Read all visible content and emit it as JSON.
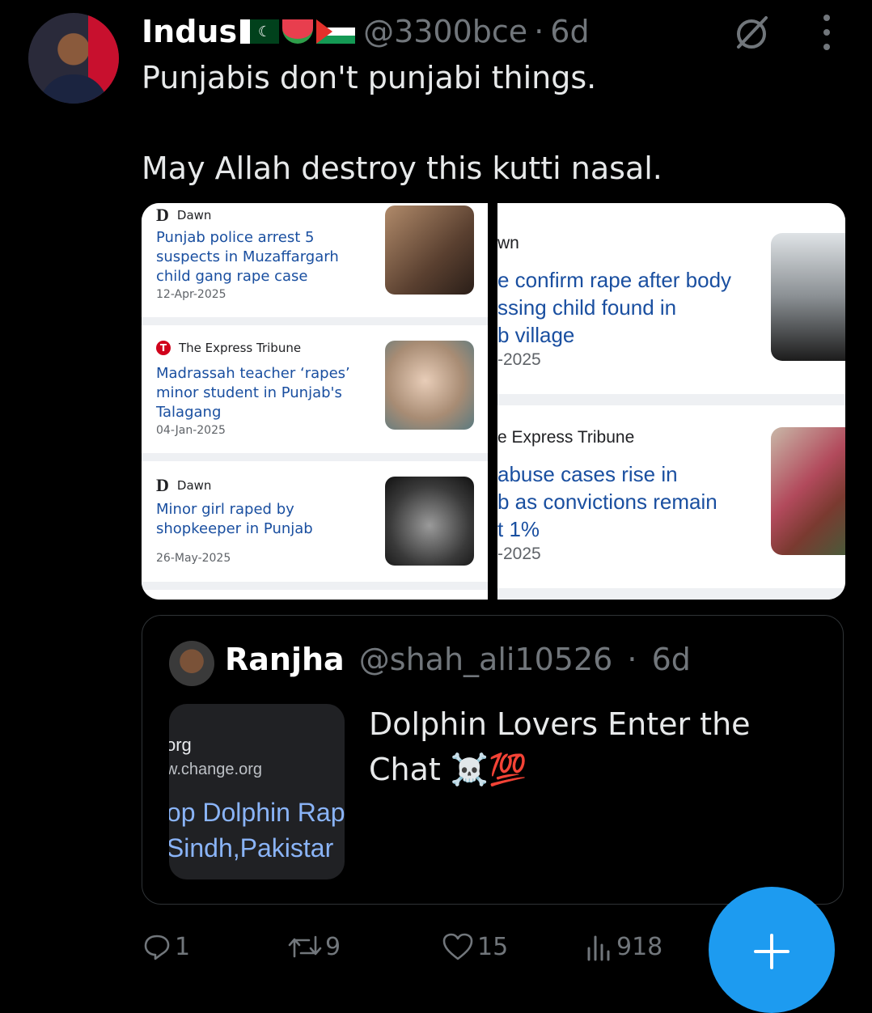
{
  "tweet": {
    "author_name": "Indus",
    "flag_emojis": [
      "pakistan-flag",
      "watermelon",
      "palestine-flag"
    ],
    "handle": "@3300bce",
    "separator": "·",
    "time": "6d",
    "text": "Punjabis don't punjabi things.\n\nMay Allah destroy this kutti nasal."
  },
  "media_left": {
    "cards": [
      {
        "source": "Dawn",
        "source_logo": "D",
        "headline": "Punjab police arrest 5 suspects in Muzaffargarh child gang rape case",
        "date": "12-Apr-2025"
      },
      {
        "source": "The Express Tribune",
        "source_logo": "T",
        "headline": "Madrassah teacher ‘rapes’ minor student in Punjab's Talagang",
        "date": "04-Jan-2025"
      },
      {
        "source": "Dawn",
        "source_logo": "D",
        "headline": "Minor girl raped by shopkeeper in Punjab",
        "date": "26-May-2025"
      }
    ]
  },
  "media_right": {
    "cards": [
      {
        "source": "wn",
        "headline": "e confirm rape after body\nssing child found in\nb village",
        "date": "-2025"
      },
      {
        "source": "e Express Tribune",
        "headline": "abuse cases rise in\nb as convictions remain\nt 1%",
        "date": "-2025"
      }
    ]
  },
  "quoted_tweet": {
    "author_name": "Ranjha",
    "handle": "@shah_ali10526",
    "separator": "·",
    "time": "6d",
    "media_text": {
      "line1": "org",
      "line2": "w.change.org",
      "line3": "top Dolphin Rap\n Sindh,Pakistar"
    },
    "text": "Dolphin Lovers Enter the Chat",
    "emojis": "☠️💯"
  },
  "actions": {
    "replies": "1",
    "reposts": "9",
    "likes": "15",
    "views": "918"
  },
  "colors": {
    "accent": "#1d9bf0",
    "link": "#1a4fa0",
    "muted": "#71767b"
  }
}
